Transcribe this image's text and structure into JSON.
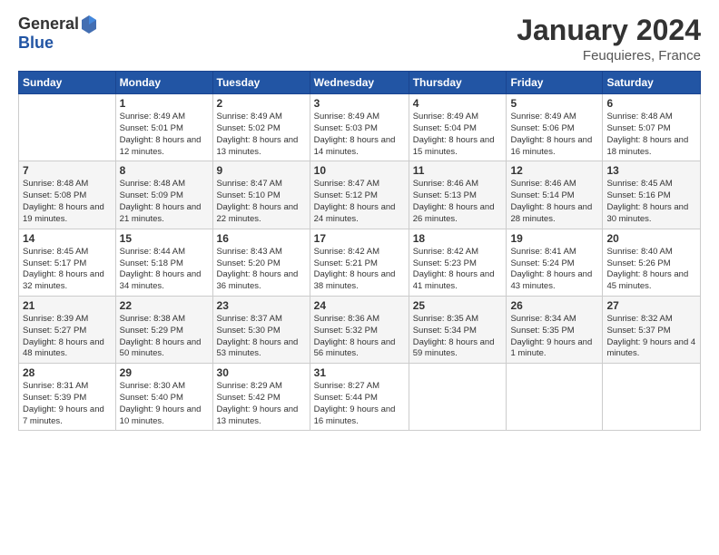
{
  "header": {
    "logo_general": "General",
    "logo_blue": "Blue",
    "main_title": "January 2024",
    "subtitle": "Feuquieres, France"
  },
  "calendar": {
    "weekdays": [
      "Sunday",
      "Monday",
      "Tuesday",
      "Wednesday",
      "Thursday",
      "Friday",
      "Saturday"
    ],
    "weeks": [
      [
        {
          "day": "",
          "sunrise": "",
          "sunset": "",
          "daylight": ""
        },
        {
          "day": "1",
          "sunrise": "Sunrise: 8:49 AM",
          "sunset": "Sunset: 5:01 PM",
          "daylight": "Daylight: 8 hours and 12 minutes."
        },
        {
          "day": "2",
          "sunrise": "Sunrise: 8:49 AM",
          "sunset": "Sunset: 5:02 PM",
          "daylight": "Daylight: 8 hours and 13 minutes."
        },
        {
          "day": "3",
          "sunrise": "Sunrise: 8:49 AM",
          "sunset": "Sunset: 5:03 PM",
          "daylight": "Daylight: 8 hours and 14 minutes."
        },
        {
          "day": "4",
          "sunrise": "Sunrise: 8:49 AM",
          "sunset": "Sunset: 5:04 PM",
          "daylight": "Daylight: 8 hours and 15 minutes."
        },
        {
          "day": "5",
          "sunrise": "Sunrise: 8:49 AM",
          "sunset": "Sunset: 5:06 PM",
          "daylight": "Daylight: 8 hours and 16 minutes."
        },
        {
          "day": "6",
          "sunrise": "Sunrise: 8:48 AM",
          "sunset": "Sunset: 5:07 PM",
          "daylight": "Daylight: 8 hours and 18 minutes."
        }
      ],
      [
        {
          "day": "7",
          "sunrise": "Sunrise: 8:48 AM",
          "sunset": "Sunset: 5:08 PM",
          "daylight": "Daylight: 8 hours and 19 minutes."
        },
        {
          "day": "8",
          "sunrise": "Sunrise: 8:48 AM",
          "sunset": "Sunset: 5:09 PM",
          "daylight": "Daylight: 8 hours and 21 minutes."
        },
        {
          "day": "9",
          "sunrise": "Sunrise: 8:47 AM",
          "sunset": "Sunset: 5:10 PM",
          "daylight": "Daylight: 8 hours and 22 minutes."
        },
        {
          "day": "10",
          "sunrise": "Sunrise: 8:47 AM",
          "sunset": "Sunset: 5:12 PM",
          "daylight": "Daylight: 8 hours and 24 minutes."
        },
        {
          "day": "11",
          "sunrise": "Sunrise: 8:46 AM",
          "sunset": "Sunset: 5:13 PM",
          "daylight": "Daylight: 8 hours and 26 minutes."
        },
        {
          "day": "12",
          "sunrise": "Sunrise: 8:46 AM",
          "sunset": "Sunset: 5:14 PM",
          "daylight": "Daylight: 8 hours and 28 minutes."
        },
        {
          "day": "13",
          "sunrise": "Sunrise: 8:45 AM",
          "sunset": "Sunset: 5:16 PM",
          "daylight": "Daylight: 8 hours and 30 minutes."
        }
      ],
      [
        {
          "day": "14",
          "sunrise": "Sunrise: 8:45 AM",
          "sunset": "Sunset: 5:17 PM",
          "daylight": "Daylight: 8 hours and 32 minutes."
        },
        {
          "day": "15",
          "sunrise": "Sunrise: 8:44 AM",
          "sunset": "Sunset: 5:18 PM",
          "daylight": "Daylight: 8 hours and 34 minutes."
        },
        {
          "day": "16",
          "sunrise": "Sunrise: 8:43 AM",
          "sunset": "Sunset: 5:20 PM",
          "daylight": "Daylight: 8 hours and 36 minutes."
        },
        {
          "day": "17",
          "sunrise": "Sunrise: 8:42 AM",
          "sunset": "Sunset: 5:21 PM",
          "daylight": "Daylight: 8 hours and 38 minutes."
        },
        {
          "day": "18",
          "sunrise": "Sunrise: 8:42 AM",
          "sunset": "Sunset: 5:23 PM",
          "daylight": "Daylight: 8 hours and 41 minutes."
        },
        {
          "day": "19",
          "sunrise": "Sunrise: 8:41 AM",
          "sunset": "Sunset: 5:24 PM",
          "daylight": "Daylight: 8 hours and 43 minutes."
        },
        {
          "day": "20",
          "sunrise": "Sunrise: 8:40 AM",
          "sunset": "Sunset: 5:26 PM",
          "daylight": "Daylight: 8 hours and 45 minutes."
        }
      ],
      [
        {
          "day": "21",
          "sunrise": "Sunrise: 8:39 AM",
          "sunset": "Sunset: 5:27 PM",
          "daylight": "Daylight: 8 hours and 48 minutes."
        },
        {
          "day": "22",
          "sunrise": "Sunrise: 8:38 AM",
          "sunset": "Sunset: 5:29 PM",
          "daylight": "Daylight: 8 hours and 50 minutes."
        },
        {
          "day": "23",
          "sunrise": "Sunrise: 8:37 AM",
          "sunset": "Sunset: 5:30 PM",
          "daylight": "Daylight: 8 hours and 53 minutes."
        },
        {
          "day": "24",
          "sunrise": "Sunrise: 8:36 AM",
          "sunset": "Sunset: 5:32 PM",
          "daylight": "Daylight: 8 hours and 56 minutes."
        },
        {
          "day": "25",
          "sunrise": "Sunrise: 8:35 AM",
          "sunset": "Sunset: 5:34 PM",
          "daylight": "Daylight: 8 hours and 59 minutes."
        },
        {
          "day": "26",
          "sunrise": "Sunrise: 8:34 AM",
          "sunset": "Sunset: 5:35 PM",
          "daylight": "Daylight: 9 hours and 1 minute."
        },
        {
          "day": "27",
          "sunrise": "Sunrise: 8:32 AM",
          "sunset": "Sunset: 5:37 PM",
          "daylight": "Daylight: 9 hours and 4 minutes."
        }
      ],
      [
        {
          "day": "28",
          "sunrise": "Sunrise: 8:31 AM",
          "sunset": "Sunset: 5:39 PM",
          "daylight": "Daylight: 9 hours and 7 minutes."
        },
        {
          "day": "29",
          "sunrise": "Sunrise: 8:30 AM",
          "sunset": "Sunset: 5:40 PM",
          "daylight": "Daylight: 9 hours and 10 minutes."
        },
        {
          "day": "30",
          "sunrise": "Sunrise: 8:29 AM",
          "sunset": "Sunset: 5:42 PM",
          "daylight": "Daylight: 9 hours and 13 minutes."
        },
        {
          "day": "31",
          "sunrise": "Sunrise: 8:27 AM",
          "sunset": "Sunset: 5:44 PM",
          "daylight": "Daylight: 9 hours and 16 minutes."
        },
        {
          "day": "",
          "sunrise": "",
          "sunset": "",
          "daylight": ""
        },
        {
          "day": "",
          "sunrise": "",
          "sunset": "",
          "daylight": ""
        },
        {
          "day": "",
          "sunrise": "",
          "sunset": "",
          "daylight": ""
        }
      ]
    ]
  }
}
